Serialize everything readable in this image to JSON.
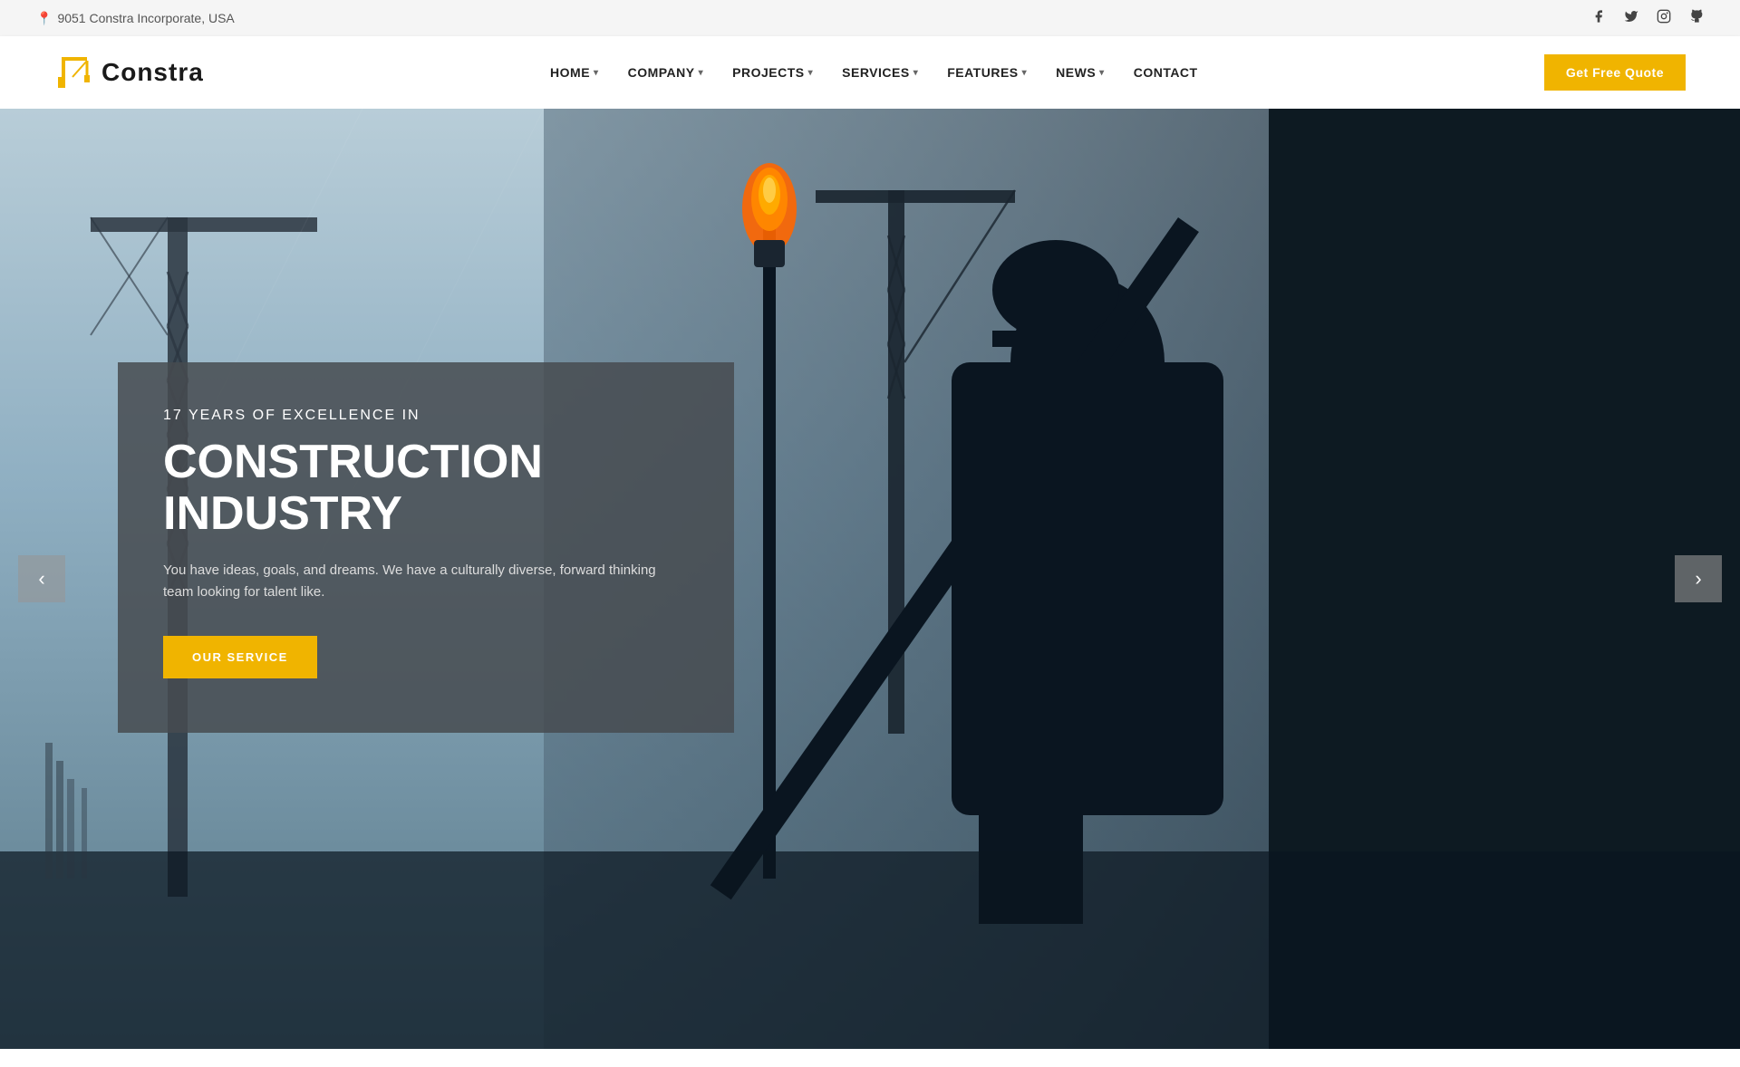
{
  "topbar": {
    "address": "9051 Constra Incorporate, USA",
    "address_icon": "📍"
  },
  "social": {
    "facebook": "f",
    "twitter": "𝕏",
    "instagram": "📷",
    "github": "⌨"
  },
  "logo": {
    "text": "Constra",
    "icon": "🏗"
  },
  "nav": {
    "items": [
      {
        "label": "HOME",
        "has_dropdown": true
      },
      {
        "label": "COMPANY",
        "has_dropdown": true
      },
      {
        "label": "PROJECTS",
        "has_dropdown": true
      },
      {
        "label": "SERVICES",
        "has_dropdown": true
      },
      {
        "label": "FEATURES",
        "has_dropdown": true
      },
      {
        "label": "NEWS",
        "has_dropdown": true
      },
      {
        "label": "CONTACT",
        "has_dropdown": false
      }
    ],
    "cta_label": "Get Free Quote"
  },
  "hero": {
    "subtitle": "17 YEARS OF EXCELLENCE IN",
    "title": "CONSTRUCTION INDUSTRY",
    "description": "You have ideas, goals, and dreams. We have a culturally diverse, forward thinking team looking for talent like.",
    "button_label": "OUR SERVICE"
  },
  "slider": {
    "prev_label": "‹",
    "next_label": "›"
  }
}
